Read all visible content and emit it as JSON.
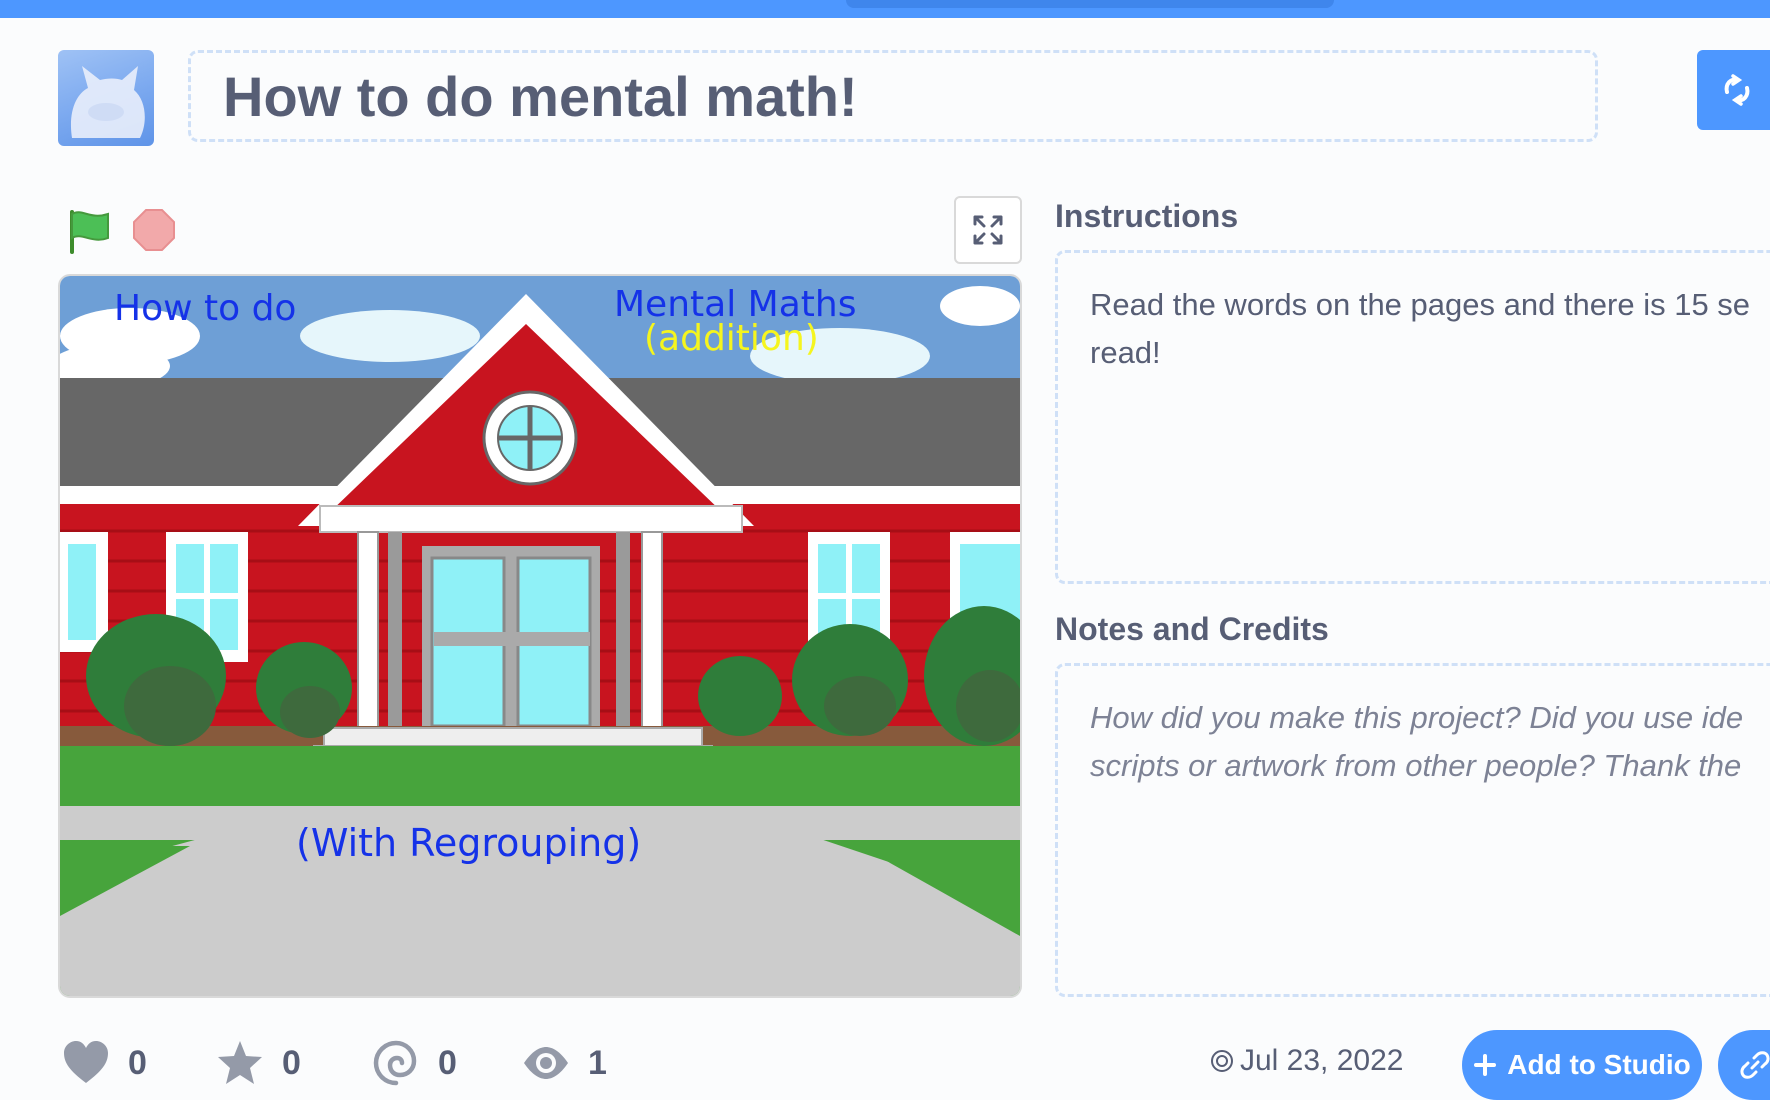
{
  "project": {
    "title": "How to do mental math!"
  },
  "stage": {
    "texts": {
      "how_to_do": "How to do",
      "mental_maths": "Mental Maths",
      "addition": "(addition)",
      "with_regrouping": "(With Regrouping)"
    }
  },
  "instructions": {
    "label": "Instructions",
    "line1": "Read the words on the pages and there is 15 se",
    "line2": "read!"
  },
  "notes": {
    "label": "Notes and Credits",
    "line1": "How did you make this project? Did you use ide",
    "line2": "scripts or artwork from other people? Thank the"
  },
  "stats": {
    "loves": "0",
    "favorites": "0",
    "remixes": "0",
    "views": "1"
  },
  "date": "Jul 23, 2022",
  "buttons": {
    "add_to_studio": "Add to Studio"
  },
  "colors": {
    "accent": "#4d97ff",
    "text": "#575e75"
  },
  "icons": {
    "remix": "remix-icon",
    "flag": "green-flag-icon",
    "stop": "stop-icon",
    "fullscreen": "fullscreen-icon",
    "love": "heart-icon",
    "favorite": "star-icon",
    "remixes": "remix-swirl-icon",
    "views": "eye-icon",
    "date": "copyright-icon",
    "link": "link-icon"
  }
}
